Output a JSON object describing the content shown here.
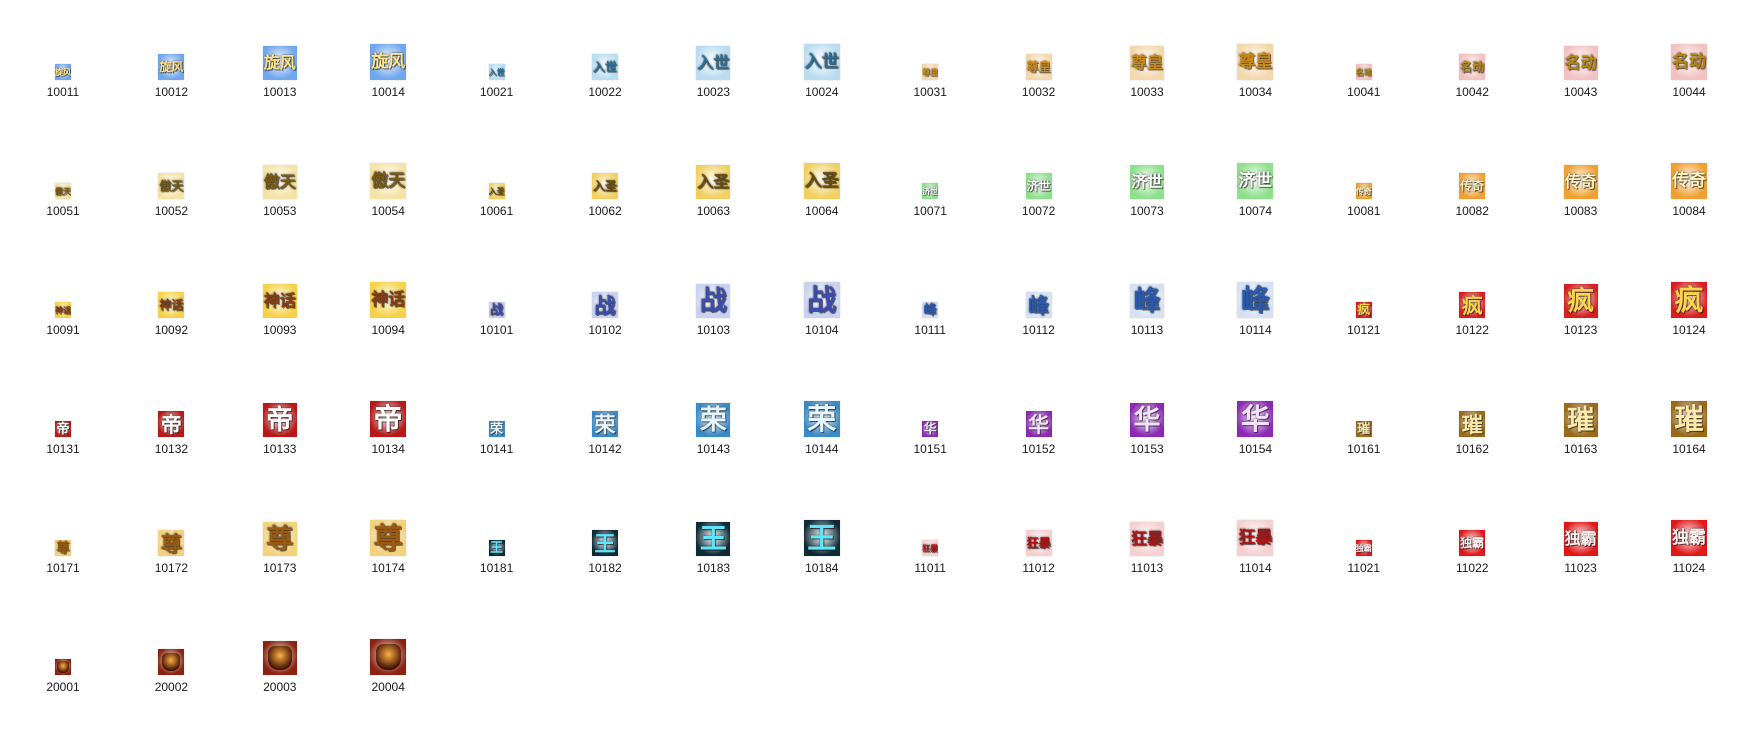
{
  "files": [
    {
      "name": "10011",
      "glyph": "旋风",
      "bg": "#6fa6ee",
      "fg": "#ffe38a"
    },
    {
      "name": "10012",
      "glyph": "旋风",
      "bg": "#6fa6ee",
      "fg": "#ffe38a"
    },
    {
      "name": "10013",
      "glyph": "旋风",
      "bg": "#6fa6ee",
      "fg": "#ffe38a"
    },
    {
      "name": "10014",
      "glyph": "旋风",
      "bg": "#6fa6ee",
      "fg": "#ffe38a"
    },
    {
      "name": "10021",
      "glyph": "入世",
      "bg": "#b9dcef",
      "fg": "#2a6f9a"
    },
    {
      "name": "10022",
      "glyph": "入世",
      "bg": "#b9dcef",
      "fg": "#2a6f9a"
    },
    {
      "name": "10023",
      "glyph": "入世",
      "bg": "#b9dcef",
      "fg": "#2a6f9a"
    },
    {
      "name": "10024",
      "glyph": "入世",
      "bg": "#b9dcef",
      "fg": "#2a6f9a"
    },
    {
      "name": "10031",
      "glyph": "尊皇",
      "bg": "#f3d8ae",
      "fg": "#c98a18"
    },
    {
      "name": "10032",
      "glyph": "尊皇",
      "bg": "#f3d8ae",
      "fg": "#c98a18"
    },
    {
      "name": "10033",
      "glyph": "尊皇",
      "bg": "#f3d8ae",
      "fg": "#c98a18"
    },
    {
      "name": "10034",
      "glyph": "尊皇",
      "bg": "#f3d8ae",
      "fg": "#c98a18"
    },
    {
      "name": "10041",
      "glyph": "名动",
      "bg": "#f2c2c2",
      "fg": "#b8860b"
    },
    {
      "name": "10042",
      "glyph": "名动",
      "bg": "#f2c2c2",
      "fg": "#b8860b"
    },
    {
      "name": "10043",
      "glyph": "名动",
      "bg": "#f2c2c2",
      "fg": "#b8860b"
    },
    {
      "name": "10044",
      "glyph": "名动",
      "bg": "#f2c2c2",
      "fg": "#b8860b"
    },
    {
      "name": "10051",
      "glyph": "傲天",
      "bg": "#f3e3a6",
      "fg": "#7a5a10"
    },
    {
      "name": "10052",
      "glyph": "傲天",
      "bg": "#f3e3a6",
      "fg": "#7a5a10"
    },
    {
      "name": "10053",
      "glyph": "傲天",
      "bg": "#f3e3a6",
      "fg": "#7a5a10"
    },
    {
      "name": "10054",
      "glyph": "傲天",
      "bg": "#f3e3a6",
      "fg": "#7a5a10"
    },
    {
      "name": "10061",
      "glyph": "入圣",
      "bg": "#f0d060",
      "fg": "#6a4a08"
    },
    {
      "name": "10062",
      "glyph": "入圣",
      "bg": "#f0d060",
      "fg": "#6a4a08"
    },
    {
      "name": "10063",
      "glyph": "入圣",
      "bg": "#f0d060",
      "fg": "#6a4a08"
    },
    {
      "name": "10064",
      "glyph": "入圣",
      "bg": "#f0d060",
      "fg": "#6a4a08"
    },
    {
      "name": "10071",
      "glyph": "济世",
      "bg": "#8ee08c",
      "fg": "#ffffff"
    },
    {
      "name": "10072",
      "glyph": "济世",
      "bg": "#8ee08c",
      "fg": "#ffffff"
    },
    {
      "name": "10073",
      "glyph": "济世",
      "bg": "#8ee08c",
      "fg": "#ffffff"
    },
    {
      "name": "10074",
      "glyph": "济世",
      "bg": "#8ee08c",
      "fg": "#ffffff"
    },
    {
      "name": "10081",
      "glyph": "传奇",
      "bg": "#f0a030",
      "fg": "#fff2c0"
    },
    {
      "name": "10082",
      "glyph": "传奇",
      "bg": "#f0a030",
      "fg": "#fff2c0"
    },
    {
      "name": "10083",
      "glyph": "传奇",
      "bg": "#f0a030",
      "fg": "#fff2c0"
    },
    {
      "name": "10084",
      "glyph": "传奇",
      "bg": "#f0a030",
      "fg": "#fff2c0"
    },
    {
      "name": "10091",
      "glyph": "神话",
      "bg": "#f6d24a",
      "fg": "#8a3a10"
    },
    {
      "name": "10092",
      "glyph": "神话",
      "bg": "#f6d24a",
      "fg": "#8a3a10"
    },
    {
      "name": "10093",
      "glyph": "神话",
      "bg": "#f6d24a",
      "fg": "#8a3a10"
    },
    {
      "name": "10094",
      "glyph": "神话",
      "bg": "#f6d24a",
      "fg": "#8a3a10"
    },
    {
      "name": "10101",
      "glyph": "战",
      "bg": "#c9d2ee",
      "fg": "#3a4cb0"
    },
    {
      "name": "10102",
      "glyph": "战",
      "bg": "#c9d2ee",
      "fg": "#3a4cb0"
    },
    {
      "name": "10103",
      "glyph": "战",
      "bg": "#c9d2ee",
      "fg": "#3a4cb0"
    },
    {
      "name": "10104",
      "glyph": "战",
      "bg": "#c9d2ee",
      "fg": "#3a4cb0"
    },
    {
      "name": "10111",
      "glyph": "峰",
      "bg": "#d6e2f4",
      "fg": "#2a5ab0"
    },
    {
      "name": "10112",
      "glyph": "峰",
      "bg": "#d6e2f4",
      "fg": "#2a5ab0"
    },
    {
      "name": "10113",
      "glyph": "峰",
      "bg": "#d6e2f4",
      "fg": "#2a5ab0"
    },
    {
      "name": "10114",
      "glyph": "峰",
      "bg": "#d6e2f4",
      "fg": "#2a5ab0"
    },
    {
      "name": "10121",
      "glyph": "疯",
      "bg": "#d81e1e",
      "fg": "#ffd34a"
    },
    {
      "name": "10122",
      "glyph": "疯",
      "bg": "#d81e1e",
      "fg": "#ffd34a"
    },
    {
      "name": "10123",
      "glyph": "疯",
      "bg": "#d81e1e",
      "fg": "#ffd34a"
    },
    {
      "name": "10124",
      "glyph": "疯",
      "bg": "#d81e1e",
      "fg": "#ffd34a"
    },
    {
      "name": "10131",
      "glyph": "帝",
      "bg": "#b81818",
      "fg": "#ffffff"
    },
    {
      "name": "10132",
      "glyph": "帝",
      "bg": "#b81818",
      "fg": "#ffffff"
    },
    {
      "name": "10133",
      "glyph": "帝",
      "bg": "#b81818",
      "fg": "#ffffff"
    },
    {
      "name": "10134",
      "glyph": "帝",
      "bg": "#b81818",
      "fg": "#ffffff"
    },
    {
      "name": "10141",
      "glyph": "荣",
      "bg": "#3a8ac8",
      "fg": "#e6f6ff"
    },
    {
      "name": "10142",
      "glyph": "荣",
      "bg": "#3a8ac8",
      "fg": "#e6f6ff"
    },
    {
      "name": "10143",
      "glyph": "荣",
      "bg": "#3a8ac8",
      "fg": "#e6f6ff"
    },
    {
      "name": "10144",
      "glyph": "荣",
      "bg": "#3a8ac8",
      "fg": "#e6f6ff"
    },
    {
      "name": "10151",
      "glyph": "华",
      "bg": "#8a2ab4",
      "fg": "#f6e0ff"
    },
    {
      "name": "10152",
      "glyph": "华",
      "bg": "#8a2ab4",
      "fg": "#f6e0ff"
    },
    {
      "name": "10153",
      "glyph": "华",
      "bg": "#8a2ab4",
      "fg": "#f6e0ff"
    },
    {
      "name": "10154",
      "glyph": "华",
      "bg": "#8a2ab4",
      "fg": "#f6e0ff"
    },
    {
      "name": "10161",
      "glyph": "璀",
      "bg": "#9a6a1a",
      "fg": "#ffe9a8"
    },
    {
      "name": "10162",
      "glyph": "璀",
      "bg": "#9a6a1a",
      "fg": "#ffe9a8"
    },
    {
      "name": "10163",
      "glyph": "璀",
      "bg": "#9a6a1a",
      "fg": "#ffe9a8"
    },
    {
      "name": "10164",
      "glyph": "璀",
      "bg": "#9a6a1a",
      "fg": "#ffe9a8"
    },
    {
      "name": "10171",
      "glyph": "尊",
      "bg": "#f3d27a",
      "fg": "#9a5a10"
    },
    {
      "name": "10172",
      "glyph": "尊",
      "bg": "#f3d27a",
      "fg": "#9a5a10"
    },
    {
      "name": "10173",
      "glyph": "尊",
      "bg": "#f3d27a",
      "fg": "#9a5a10"
    },
    {
      "name": "10174",
      "glyph": "尊",
      "bg": "#f3d27a",
      "fg": "#9a5a10"
    },
    {
      "name": "10181",
      "glyph": "王",
      "bg": "#0e2a34",
      "fg": "#5ee6ff"
    },
    {
      "name": "10182",
      "glyph": "王",
      "bg": "#0e2a34",
      "fg": "#5ee6ff"
    },
    {
      "name": "10183",
      "glyph": "王",
      "bg": "#0e2a34",
      "fg": "#5ee6ff"
    },
    {
      "name": "10184",
      "glyph": "王",
      "bg": "#0e2a34",
      "fg": "#5ee6ff"
    },
    {
      "name": "11011",
      "glyph": "狂暴",
      "bg": "#f4d0d0",
      "fg": "#b01010"
    },
    {
      "name": "11012",
      "glyph": "狂暴",
      "bg": "#f4d0d0",
      "fg": "#b01010"
    },
    {
      "name": "11013",
      "glyph": "狂暴",
      "bg": "#f4d0d0",
      "fg": "#b01010"
    },
    {
      "name": "11014",
      "glyph": "狂暴",
      "bg": "#f4d0d0",
      "fg": "#b01010"
    },
    {
      "name": "11021",
      "glyph": "独霸",
      "bg": "#e01818",
      "fg": "#fff0f0"
    },
    {
      "name": "11022",
      "glyph": "独霸",
      "bg": "#e01818",
      "fg": "#fff0f0"
    },
    {
      "name": "11023",
      "glyph": "独霸",
      "bg": "#e01818",
      "fg": "#fff0f0"
    },
    {
      "name": "11024",
      "glyph": "独霸",
      "bg": "#e01818",
      "fg": "#fff0f0"
    },
    {
      "name": "20001",
      "glyph": "",
      "bg": "#8a2410",
      "fg": "#ffb040"
    },
    {
      "name": "20002",
      "glyph": "",
      "bg": "#8a2410",
      "fg": "#ffb040"
    },
    {
      "name": "20003",
      "glyph": "",
      "bg": "#8a2410",
      "fg": "#ffb040"
    },
    {
      "name": "20004",
      "glyph": "",
      "bg": "#8a2410",
      "fg": "#ffb040"
    }
  ]
}
